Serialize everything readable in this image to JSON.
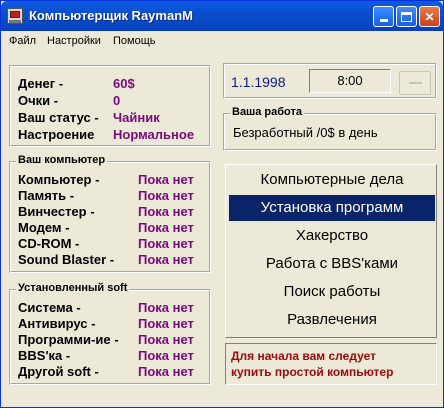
{
  "window": {
    "title": "Компьютерщик RaymanM"
  },
  "menu": [
    "Файл",
    "Настройки",
    "Помощь"
  ],
  "stats": [
    {
      "label": "Денег -",
      "value": "60$"
    },
    {
      "label": "Очки -",
      "value": "0"
    },
    {
      "label": "Ваш статус -",
      "value": "Чайник"
    },
    {
      "label": "Настроение",
      "value": "Нормальное"
    }
  ],
  "date": "1.1.1998",
  "time": "8:00",
  "job": {
    "title": "Ваша работа",
    "text": "Безработный /0$ в день"
  },
  "computer": {
    "title": "Ваш компьютер",
    "items": [
      {
        "label": "Компьютер -",
        "value": "Пока нет"
      },
      {
        "label": "Память -",
        "value": "Пока нет"
      },
      {
        "label": "Винчестер -",
        "value": "Пока нет"
      },
      {
        "label": "Модем -",
        "value": "Пока нет"
      },
      {
        "label": "CD-ROM -",
        "value": "Пока нет"
      },
      {
        "label": "Sound Blaster -",
        "value": "Пока нет"
      }
    ]
  },
  "software": {
    "title": "Установленный soft",
    "items": [
      {
        "label": "Система -",
        "value": "Пока нет"
      },
      {
        "label": "Антивирус -",
        "value": "Пока нет"
      },
      {
        "label": "Программи-ие -",
        "value": "Пока нет"
      },
      {
        "label": "BBS'ка -",
        "value": "Пока нет"
      },
      {
        "label": "Другой soft -",
        "value": "Пока нет"
      }
    ]
  },
  "actions": [
    "Компьютерные дела",
    "Установка программ",
    "Хакерство",
    "Работа с BBS'ками",
    "Поиск работы",
    "Развлечения"
  ],
  "message": {
    "line1": "Для начала вам следует",
    "line2": "купить простой компьютер"
  },
  "colors": {
    "value": "#7a0a7a",
    "highlight": "#0a246a",
    "message": "#9a0a0a",
    "date": "#0a1a8a"
  }
}
